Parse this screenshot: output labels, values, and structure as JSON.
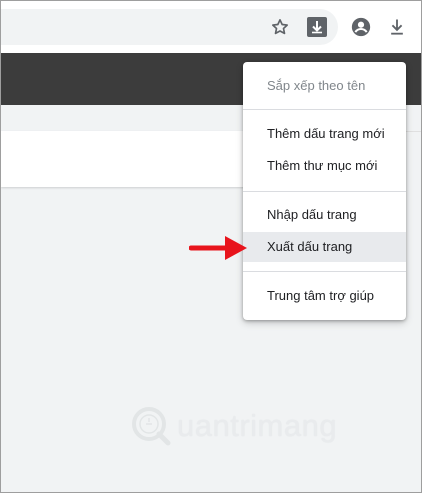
{
  "toolbar": {
    "icons": [
      "star-icon",
      "extension-download-icon",
      "account-circle-icon",
      "download-icon"
    ]
  },
  "menu": {
    "items": [
      {
        "label": "Sắp xếp theo tên",
        "enabled": false
      },
      {
        "label": "Thêm dấu trang mới",
        "enabled": true
      },
      {
        "label": "Thêm thư mục mới",
        "enabled": true
      },
      {
        "label": "Nhập dấu trang",
        "enabled": true
      },
      {
        "label": "Xuất dấu trang",
        "enabled": true,
        "highlighted": true
      },
      {
        "label": "Trung tâm trợ giúp",
        "enabled": true
      }
    ]
  },
  "annotation": {
    "icon": "red-arrow-icon",
    "color": "#e8141c"
  },
  "watermark": {
    "text": "uantrimang"
  },
  "colors": {
    "header": "#3c3c3c",
    "menu_highlight": "#e8eaed",
    "arrow": "#e8141c"
  }
}
